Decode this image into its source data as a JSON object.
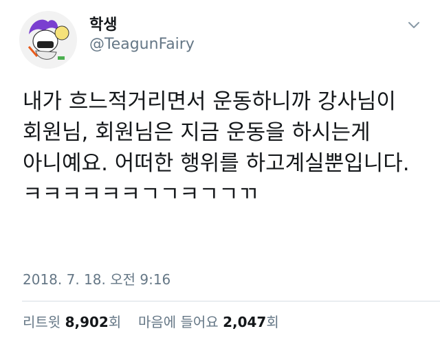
{
  "tweet": {
    "author_name": "학생",
    "author_handle": "@TeagunFairy",
    "text": "내가 흐느적거리면서 운동하니까 강사님이 회원님, 회원님은 지금 운동을 하시는게 아니예요. 어떠한 행위를 하고계실뿐입니다.\nㅋㅋㅋㅋㅋㅋㄱㄱㅋㄱㄱㄲ",
    "timestamp": "2018. 7. 18. 오전 9:16",
    "retweets_label": "리트윗",
    "retweets_count": "8,902",
    "retweets_unit": "회",
    "likes_label": "마음에 들어요",
    "likes_count": "2,047",
    "likes_unit": "회",
    "avatar_icon": "cartoon-character-avatar",
    "menu_icon": "chevron-down-icon"
  },
  "colors": {
    "text_primary": "#14171a",
    "text_secondary": "#657786",
    "divider": "#d6dde3",
    "background": "#ffffff"
  }
}
